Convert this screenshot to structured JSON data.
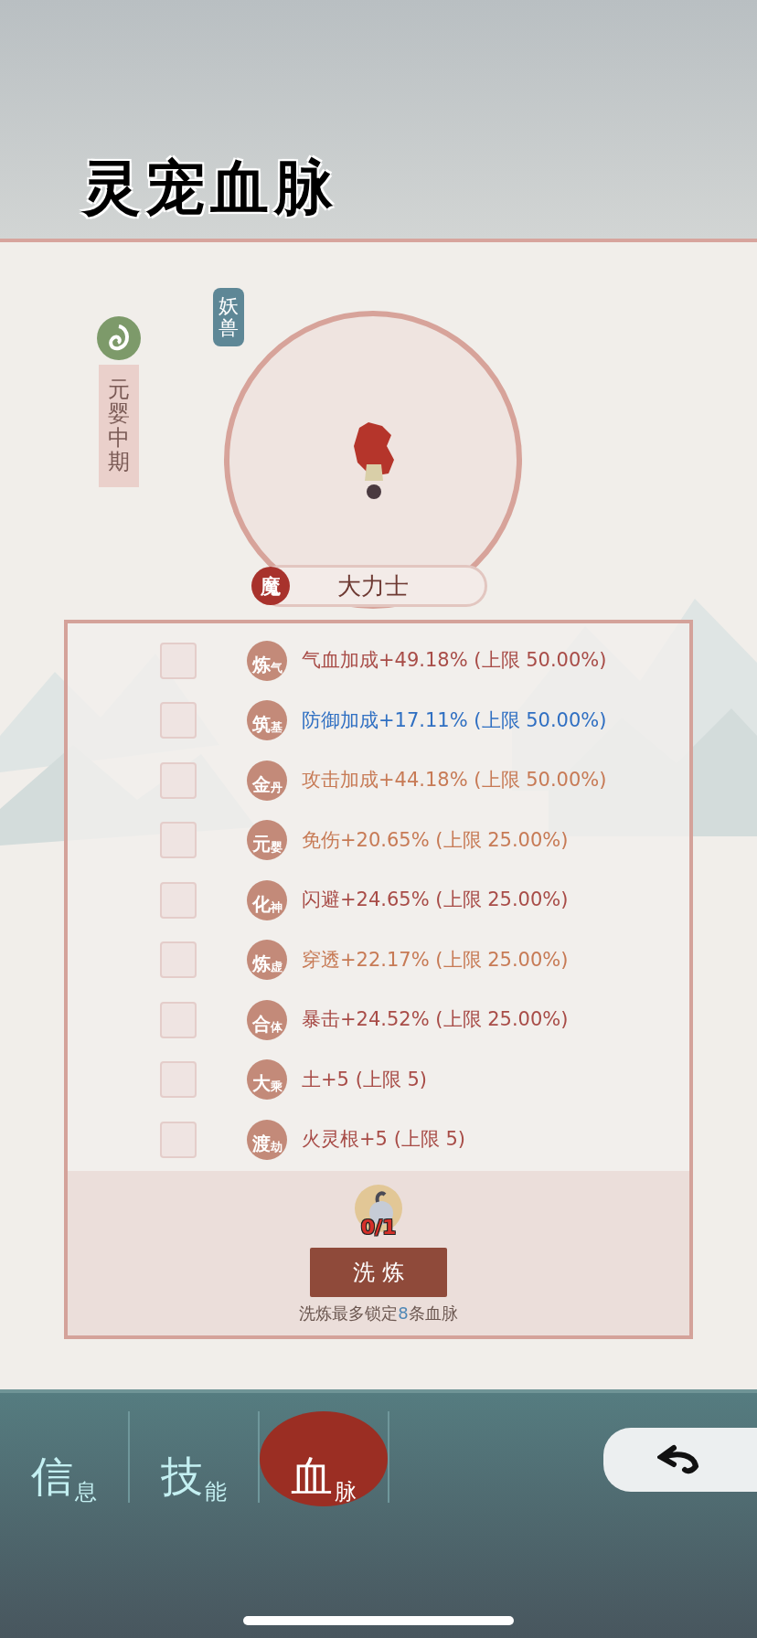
{
  "title": "灵宠血脉",
  "pet": {
    "realm": "元婴中期",
    "type_tag": "妖兽",
    "race_badge": "魔",
    "name": "大力士"
  },
  "bloodlines": [
    {
      "grade_main": "炼",
      "grade_sub": "气",
      "text": "气血加成+49.18% (上限 50.00%)",
      "color": "#a84c47",
      "checked": false
    },
    {
      "grade_main": "筑",
      "grade_sub": "基",
      "text": "防御加成+17.11% (上限 50.00%)",
      "color": "#2f6fc2",
      "checked": false
    },
    {
      "grade_main": "金",
      "grade_sub": "丹",
      "text": "攻击加成+44.18% (上限 50.00%)",
      "color": "#c77a55",
      "checked": false
    },
    {
      "grade_main": "元",
      "grade_sub": "婴",
      "text": "免伤+20.65% (上限 25.00%)",
      "color": "#c77a55",
      "checked": false
    },
    {
      "grade_main": "化",
      "grade_sub": "神",
      "text": "闪避+24.65% (上限 25.00%)",
      "color": "#a84c47",
      "checked": false
    },
    {
      "grade_main": "炼",
      "grade_sub": "虚",
      "text": "穿透+22.17% (上限 25.00%)",
      "color": "#c77a55",
      "checked": false
    },
    {
      "grade_main": "合",
      "grade_sub": "体",
      "text": "暴击+24.52% (上限 25.00%)",
      "color": "#a84c47",
      "checked": false
    },
    {
      "grade_main": "大",
      "grade_sub": "乘",
      "text": "土+5 (上限 5)",
      "color": "#a84c47",
      "checked": false
    },
    {
      "grade_main": "渡",
      "grade_sub": "劫",
      "text": "火灵根+5 (上限 5)",
      "color": "#a84c47",
      "checked": false
    }
  ],
  "refine": {
    "item_count": "0/1",
    "button": "洗 炼",
    "hint_before": "洗炼最多锁定",
    "hint_count": "8",
    "hint_after": "条血脉"
  },
  "tabs": [
    {
      "main": "信",
      "sub": "息",
      "selected": false
    },
    {
      "main": "技",
      "sub": "能",
      "selected": false
    },
    {
      "main": "血",
      "sub": "脉",
      "selected": true
    }
  ]
}
